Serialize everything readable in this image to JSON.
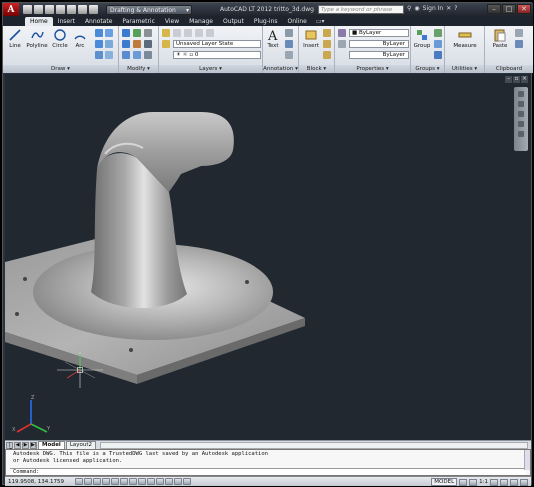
{
  "titlebar": {
    "app_letter": "A",
    "workspace": "Drafting & Annotation",
    "title": "AutoCAD LT 2012    tritto_3d.dwg",
    "search_placeholder": "Type a keyword or phrase",
    "sign_in": "Sign In"
  },
  "tabs": [
    "Home",
    "Insert",
    "Annotate",
    "Parametric",
    "View",
    "Manage",
    "Output",
    "Plug-ins",
    "Online"
  ],
  "active_tab": "Home",
  "ribbon": {
    "draw": {
      "title": "Draw",
      "line": "Line",
      "polyline": "Polyline",
      "circle": "Circle",
      "arc": "Arc"
    },
    "modify": {
      "title": "Modify"
    },
    "layers": {
      "title": "Layers",
      "layer_state": "Unsaved Layer State",
      "current_layer": "0"
    },
    "annotation": {
      "title": "Annotation",
      "text": "Text"
    },
    "block": {
      "title": "Block",
      "insert": "Insert"
    },
    "properties": {
      "title": "Properties",
      "color": "ByLayer",
      "linetype": "ByLayer",
      "lineweight": "ByLayer"
    },
    "groups": {
      "title": "Groups",
      "group": "Group"
    },
    "utilities": {
      "title": "Utilities",
      "measure": "Measure"
    },
    "clipboard": {
      "title": "Clipboard",
      "paste": "Paste"
    }
  },
  "layout_tabs": [
    "Model",
    "Layout2"
  ],
  "command": {
    "line1": "Autodesk DWG.  This file is a TrustedDWG last saved by an Autodesk application",
    "line2": "or Autodesk licensed application.",
    "prompt": "Command:"
  },
  "status": {
    "coords": "119.9508, 134.1759",
    "model": "MODEL",
    "scale": "1:1"
  },
  "colors": {
    "viewport_bg": "#212830",
    "ribbon_bg": "#e2e6eb",
    "titlebar": "#2b313a"
  }
}
